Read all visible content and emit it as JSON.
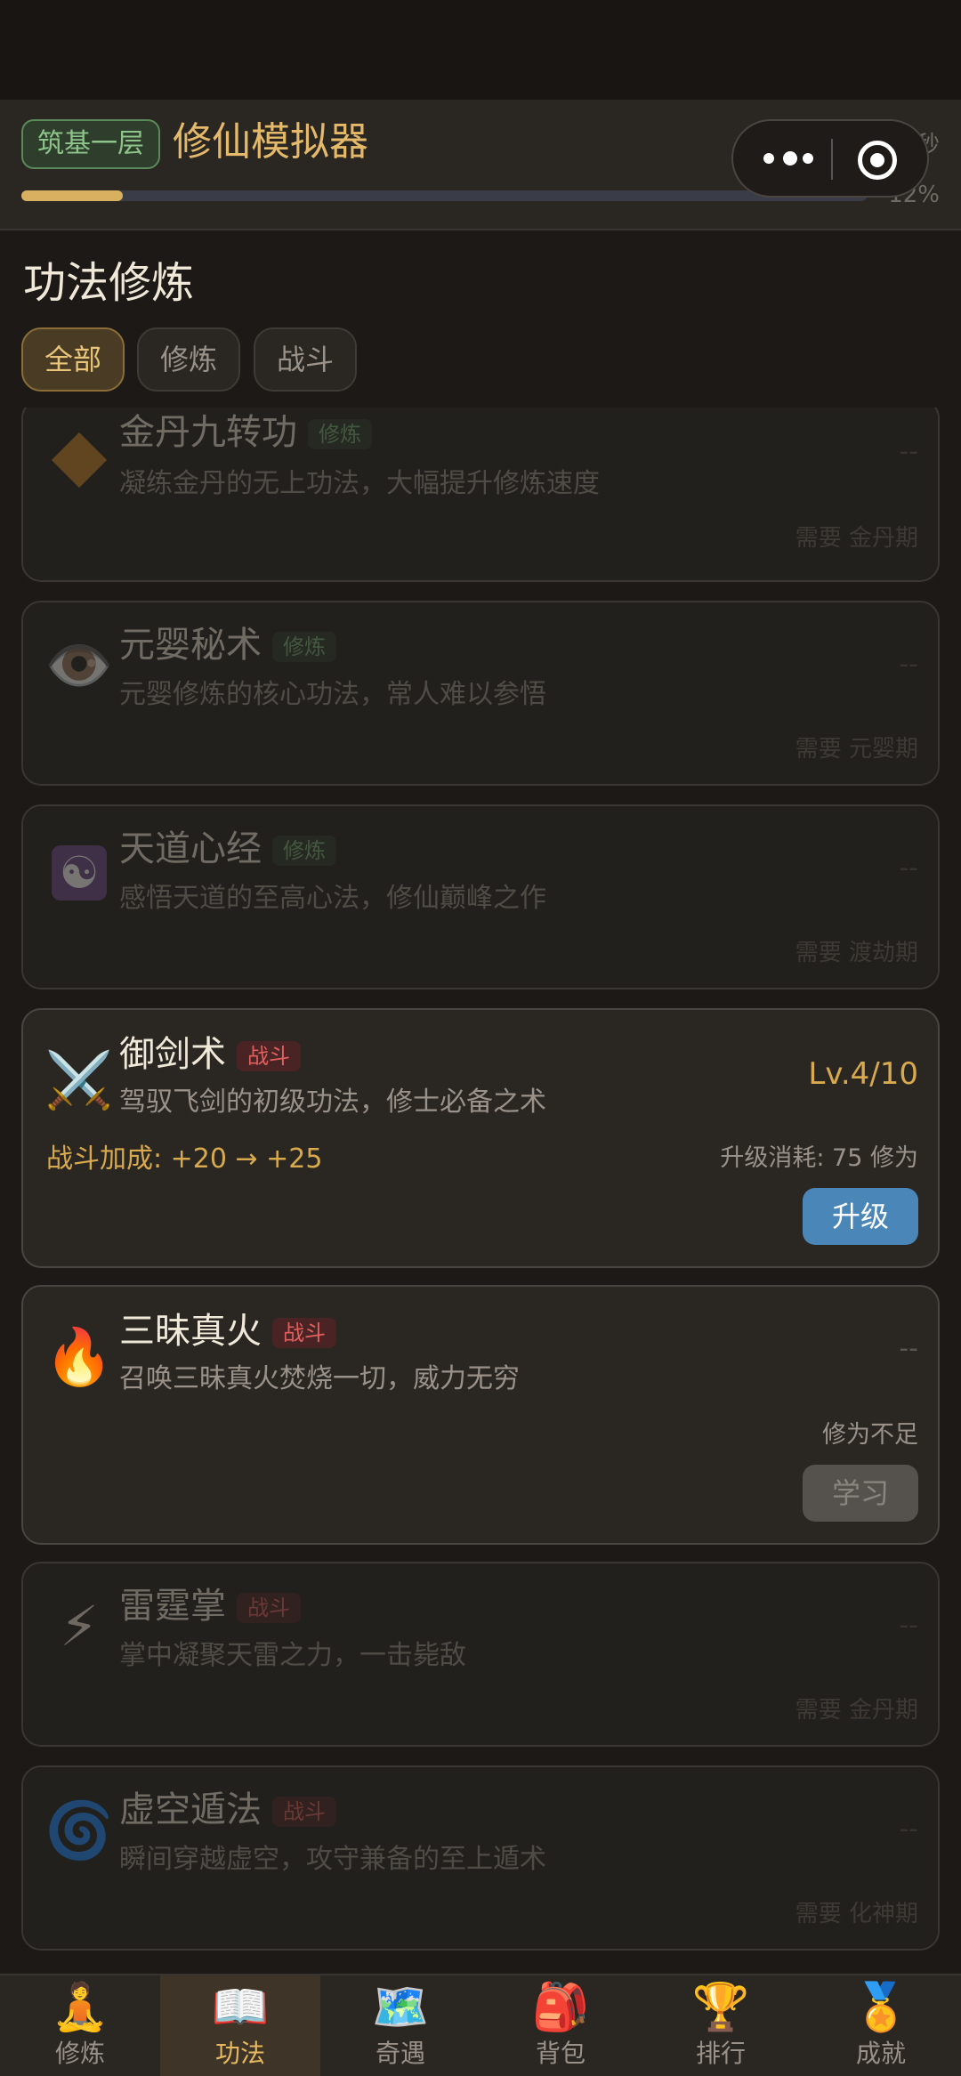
{
  "header": {
    "realm_badge": "筑基一层",
    "app_title": "修仙模拟器",
    "rate_text": "7/秒",
    "progress_percent": 12,
    "progress_label": "12%"
  },
  "section_title": "功法修炼",
  "filter_tabs": [
    {
      "label": "全部",
      "active": true
    },
    {
      "label": "修炼",
      "active": false
    },
    {
      "label": "战斗",
      "active": false
    }
  ],
  "skills": [
    {
      "icon": "diamond-icon",
      "name": "金丹九转功",
      "tag": "修炼",
      "desc": "凝练金丹的无上功法，大幅提升修炼速度",
      "level": "--",
      "requirement": "需要 金丹期"
    },
    {
      "icon": "eye-icon",
      "glyph": "👁️",
      "name": "元婴秘术",
      "tag": "修炼",
      "desc": "元婴修炼的核心功法，常人难以参悟",
      "level": "--",
      "requirement": "需要 元婴期"
    },
    {
      "icon": "yin-yang-icon",
      "glyph": "☯",
      "name": "天道心经",
      "tag": "修炼",
      "desc": "感悟天道的至高心法，修仙巅峰之作",
      "level": "--",
      "requirement": "需要 渡劫期"
    },
    {
      "icon": "crossed-swords-icon",
      "glyph": "⚔️",
      "name": "御剑术",
      "tag": "战斗",
      "desc": "驾驭飞剑的初级功法，修士必备之术",
      "level": "Lv.4/10",
      "bonus": "战斗加成: +20 → +25",
      "cost": "升级消耗: 75 修为",
      "button": "升级"
    },
    {
      "icon": "fire-icon",
      "glyph": "🔥",
      "name": "三昧真火",
      "tag": "战斗",
      "desc": "召唤三昧真火焚烧一切，威力无穷",
      "level": "--",
      "status": "修为不足",
      "button": "学习"
    },
    {
      "icon": "lightning-icon",
      "glyph": "⚡",
      "name": "雷霆掌",
      "tag": "战斗",
      "desc": "掌中凝聚天雷之力，一击毙敌",
      "level": "--",
      "requirement": "需要 金丹期"
    },
    {
      "icon": "vortex-icon",
      "glyph": "🌀",
      "name": "虚空遁法",
      "tag": "战斗",
      "desc": "瞬间穿越虚空，攻守兼备的至上遁术",
      "level": "--",
      "requirement": "需要 化神期"
    }
  ],
  "bottom_nav": [
    {
      "icon": "meditation-icon",
      "glyph": "🧘",
      "label": "修炼"
    },
    {
      "icon": "book-icon",
      "glyph": "📖",
      "label": "功法",
      "active": true
    },
    {
      "icon": "map-icon",
      "glyph": "🗺️",
      "label": "奇遇"
    },
    {
      "icon": "backpack-icon",
      "glyph": "🎒",
      "label": "背包"
    },
    {
      "icon": "trophy-icon",
      "glyph": "🏆",
      "label": "排行"
    },
    {
      "icon": "medal-icon",
      "glyph": "🏅",
      "label": "成就"
    }
  ]
}
